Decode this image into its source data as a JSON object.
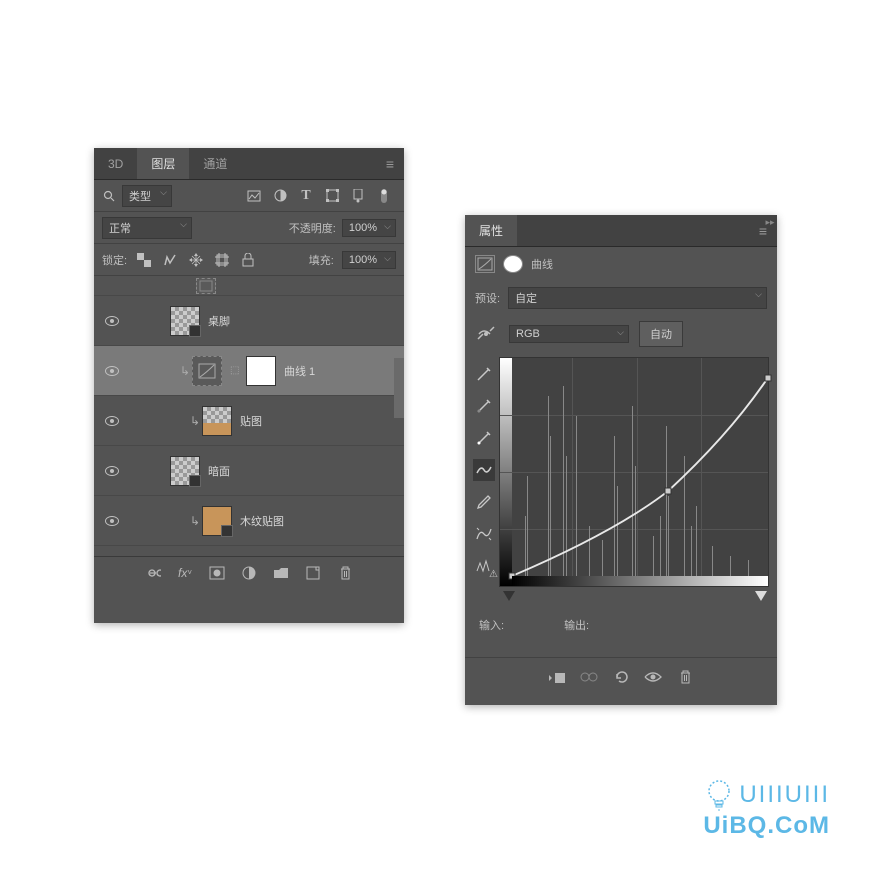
{
  "layers_panel": {
    "tabs": [
      "3D",
      "图层",
      "通道"
    ],
    "active_tab": 1,
    "filter": {
      "search_label": "类型",
      "icons": [
        "image-filter",
        "adjustment-filter",
        "type-filter",
        "shape-filter",
        "smart-filter"
      ]
    },
    "blend": {
      "mode": "正常",
      "opacity_label": "不透明度:",
      "opacity_value": "100%"
    },
    "lock": {
      "label": "锁定:",
      "fill_label": "填充:",
      "fill_value": "100%"
    },
    "layers": [
      {
        "name": "",
        "indent": 60,
        "thumb": "adj",
        "visible": false,
        "first": true
      },
      {
        "name": "桌脚",
        "indent": 40,
        "thumb": "checker",
        "visible": true,
        "smart": true
      },
      {
        "name": "曲线 1",
        "indent": 50,
        "thumb": "adj",
        "mask": true,
        "visible": true,
        "selected": true,
        "clip": true
      },
      {
        "name": "贴图",
        "indent": 60,
        "thumb": "wood1",
        "visible": true,
        "clip": true
      },
      {
        "name": "暗面",
        "indent": 40,
        "thumb": "checker",
        "visible": true,
        "smart": true
      },
      {
        "name": "木纹贴图",
        "indent": 60,
        "thumb": "wood2",
        "visible": true,
        "clip": true
      }
    ]
  },
  "props_panel": {
    "title": "属性",
    "adj_name": "曲线",
    "preset_label": "预设:",
    "preset_value": "自定",
    "channel_value": "RGB",
    "auto_label": "自动",
    "input_label": "输入:",
    "output_label": "输出:"
  },
  "chart_data": {
    "type": "line",
    "title": "曲线",
    "xlabel": "输入",
    "ylabel": "输出",
    "xlim": [
      0,
      255
    ],
    "ylim": [
      0,
      255
    ],
    "series": [
      {
        "name": "RGB",
        "points": [
          [
            0,
            0
          ],
          [
            157,
            100
          ],
          [
            255,
            233
          ]
        ]
      }
    ],
    "histogram_peaks": [
      12,
      35,
      50,
      62,
      98,
      115,
      145,
      165,
      178
    ]
  },
  "watermark": {
    "line1": "UIIIUIII",
    "line2": "UiBQ.CoM"
  }
}
